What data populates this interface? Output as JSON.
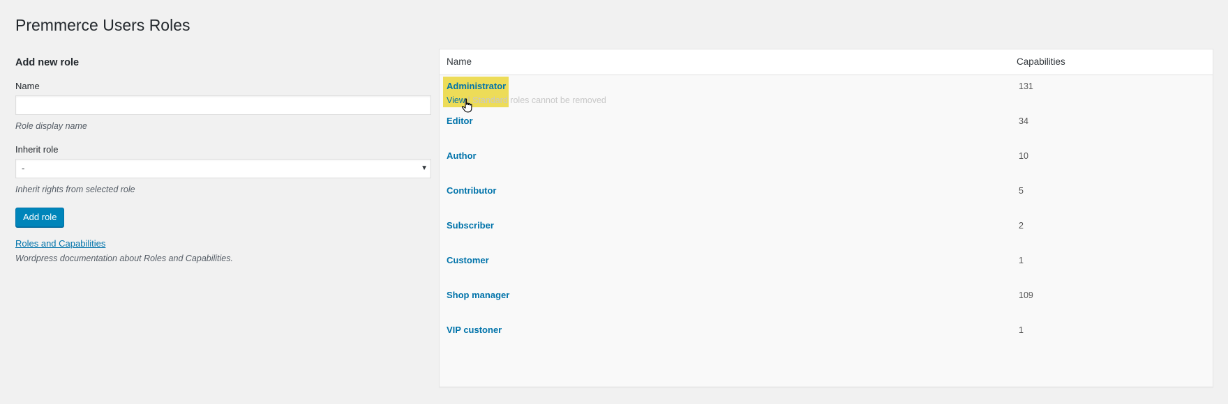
{
  "page": {
    "title": "Premmerce Users Roles"
  },
  "form": {
    "section_title": "Add new role",
    "name_label": "Name",
    "name_value": "",
    "name_help": "Role display name",
    "inherit_label": "Inherit role",
    "inherit_selected": "-",
    "inherit_help": "Inherit rights from selected role",
    "submit_label": "Add role",
    "doc_link": "Roles and Capabilities",
    "doc_desc": "Wordpress documentation about Roles and Capabilities."
  },
  "table": {
    "columns": [
      "Name",
      "Capabilities"
    ],
    "rows": [
      {
        "name": "Administrator",
        "capabilities": "131"
      },
      {
        "name": "Editor",
        "capabilities": "34"
      },
      {
        "name": "Author",
        "capabilities": "10"
      },
      {
        "name": "Contributor",
        "capabilities": "5"
      },
      {
        "name": "Subscriber",
        "capabilities": "2"
      },
      {
        "name": "Customer",
        "capabilities": "1"
      },
      {
        "name": "Shop manager",
        "capabilities": "109"
      },
      {
        "name": "VIP custoner",
        "capabilities": "1"
      }
    ],
    "hover_row_actions": {
      "view": "View",
      "separator": "|",
      "note": "Standard roles cannot be removed"
    }
  },
  "colors": {
    "link": "#0073aa",
    "primary_button": "#0085ba",
    "highlight": "#ebd73c"
  },
  "icons": {
    "cursor": "hand-pointer-icon",
    "select_arrow": "caret-down-icon"
  }
}
